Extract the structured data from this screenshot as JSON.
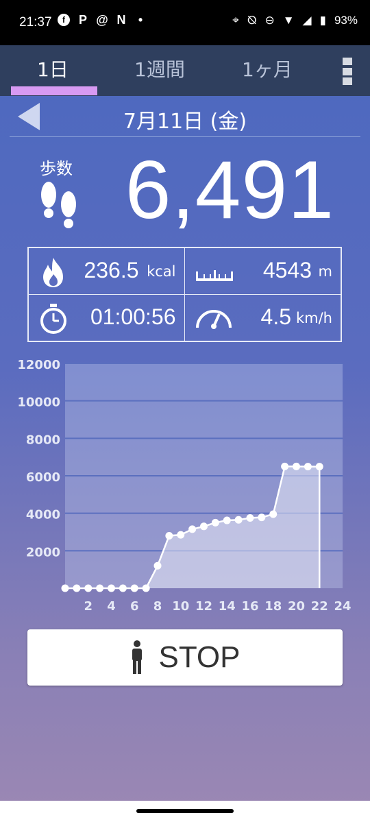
{
  "status_bar": {
    "time": "21:37",
    "app_icons": [
      "facebook-icon",
      "p-icon",
      "threads-icon",
      "n-icon"
    ],
    "battery": "93%"
  },
  "tabs": [
    {
      "label": "1日",
      "active": true
    },
    {
      "label": "1週間",
      "active": false
    },
    {
      "label": "1ヶ月",
      "active": false
    }
  ],
  "date": "7月11日 (金)",
  "steps": {
    "label": "歩数",
    "value": "6,491"
  },
  "stats": {
    "calories": {
      "value": "236.5",
      "unit": "kcal"
    },
    "distance": {
      "value": "4543",
      "unit": "m"
    },
    "time": {
      "value": "01:00:56"
    },
    "speed": {
      "value": "4.5",
      "unit": "km/h"
    }
  },
  "chart_data": {
    "type": "area",
    "x": [
      0,
      1,
      2,
      3,
      4,
      5,
      6,
      7,
      8,
      9,
      10,
      11,
      12,
      13,
      14,
      15,
      16,
      17,
      18,
      19,
      20,
      21,
      22
    ],
    "values": [
      0,
      0,
      0,
      0,
      0,
      0,
      0,
      0,
      1200,
      2800,
      2850,
      3150,
      3300,
      3500,
      3620,
      3650,
      3750,
      3780,
      3950,
      6500,
      6500,
      6490,
      6491
    ],
    "xlim": [
      0,
      24
    ],
    "ylim": [
      0,
      12000
    ],
    "x_ticks": [
      2,
      4,
      6,
      8,
      10,
      12,
      14,
      16,
      18,
      20,
      22,
      24
    ],
    "y_ticks": [
      2000,
      4000,
      6000,
      8000,
      10000,
      12000
    ],
    "grid": true
  },
  "stop_button": {
    "label": "STOP"
  }
}
